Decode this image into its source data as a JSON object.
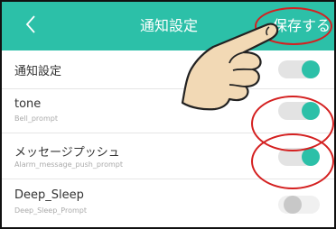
{
  "header": {
    "back_icon": "chevron-left-icon",
    "title": "通知設定",
    "save_label": "保存する"
  },
  "settings": [
    {
      "label": "通知設定",
      "sublabel": "",
      "on": true
    },
    {
      "label": "tone",
      "sublabel": "Bell_prompt",
      "on": true
    },
    {
      "label": "メッセージプッシュ",
      "sublabel": "Alarm_message_push_prompt",
      "on": true
    },
    {
      "label": "Deep_Sleep",
      "sublabel": "Deep_Sleep_Prompt",
      "on": false
    }
  ],
  "colors": {
    "accent": "#2cc0a8",
    "highlight_ring": "#d42020"
  }
}
